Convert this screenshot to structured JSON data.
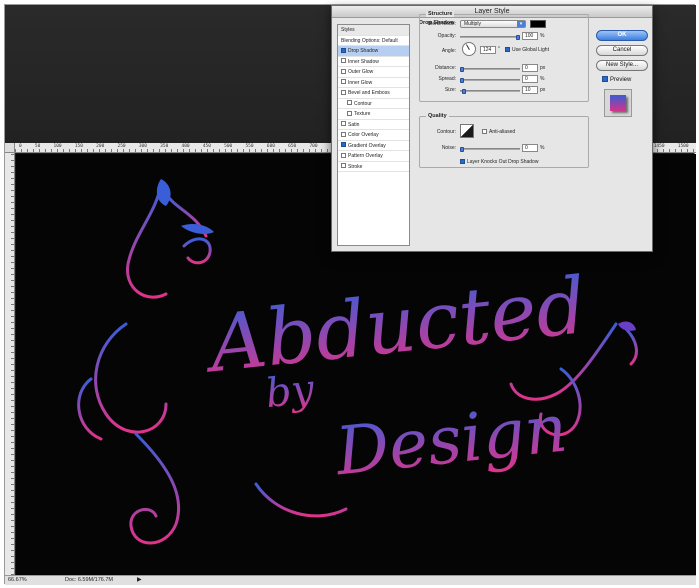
{
  "window": {
    "zoom_readout": "66.67%",
    "doc_info": "Doc: 6.59M/176.7M",
    "ruler_ticks": [
      "0",
      "50",
      "100",
      "150",
      "200",
      "250",
      "300",
      "350",
      "400",
      "450",
      "500",
      "550",
      "600",
      "650",
      "700",
      "750",
      "800",
      "850",
      "900",
      "950",
      "1000",
      "1050",
      "1100",
      "1150",
      "1200",
      "1250",
      "1300",
      "1350",
      "1400",
      "1450",
      "1500"
    ]
  },
  "artwork": {
    "line1": "Abducted",
    "line2": "by",
    "line3": "Design",
    "gradient_top": "#3a5ed8",
    "gradient_bottom": "#e0338a"
  },
  "dialog": {
    "title": "Layer Style",
    "styles_header": "Styles",
    "styles": [
      {
        "label": "Blending Options: Default",
        "checkbox": false,
        "checked": false,
        "selected": false,
        "sub": false
      },
      {
        "label": "Drop Shadow",
        "checkbox": true,
        "checked": true,
        "selected": true,
        "sub": false
      },
      {
        "label": "Inner Shadow",
        "checkbox": true,
        "checked": false,
        "selected": false,
        "sub": false
      },
      {
        "label": "Outer Glow",
        "checkbox": true,
        "checked": false,
        "selected": false,
        "sub": false
      },
      {
        "label": "Inner Glow",
        "checkbox": true,
        "checked": false,
        "selected": false,
        "sub": false
      },
      {
        "label": "Bevel and Emboss",
        "checkbox": true,
        "checked": false,
        "selected": false,
        "sub": false
      },
      {
        "label": "Contour",
        "checkbox": true,
        "checked": false,
        "selected": false,
        "sub": true
      },
      {
        "label": "Texture",
        "checkbox": true,
        "checked": false,
        "selected": false,
        "sub": true
      },
      {
        "label": "Satin",
        "checkbox": true,
        "checked": false,
        "selected": false,
        "sub": false
      },
      {
        "label": "Color Overlay",
        "checkbox": true,
        "checked": false,
        "selected": false,
        "sub": false
      },
      {
        "label": "Gradient Overlay",
        "checkbox": true,
        "checked": true,
        "selected": false,
        "sub": false
      },
      {
        "label": "Pattern Overlay",
        "checkbox": true,
        "checked": false,
        "selected": false,
        "sub": false
      },
      {
        "label": "Stroke",
        "checkbox": true,
        "checked": false,
        "selected": false,
        "sub": false
      }
    ],
    "section_title": "Drop Shadow",
    "structure_label": "Structure",
    "blend_mode_label": "Blend Mode:",
    "blend_mode_value": "Multiply",
    "shadow_color": "#000000",
    "opacity_label": "Opacity:",
    "opacity_value": "100",
    "opacity_unit": "%",
    "opacity_level": 1.0,
    "angle_label": "Angle:",
    "angle_value": "124",
    "angle_unit": "°",
    "global_light_label": "Use Global Light",
    "global_light_checked": true,
    "distance_label": "Distance:",
    "distance_value": "0",
    "distance_unit": "px",
    "distance_level": 0,
    "spread_label": "Spread:",
    "spread_value": "0",
    "spread_unit": "%",
    "spread_level": 0,
    "size_label": "Size:",
    "size_value": "10",
    "size_unit": "px",
    "size_level": 0.04,
    "quality_label": "Quality",
    "contour_label": "Contour:",
    "anti_aliased_label": "Anti-aliased",
    "noise_label": "Noise:",
    "noise_value": "0",
    "noise_unit": "%",
    "noise_level": 0,
    "knockout_label": "Layer Knocks Out Drop Shadow",
    "knockout_checked": true,
    "ok_label": "OK",
    "cancel_label": "Cancel",
    "new_style_label": "New Style...",
    "preview_label": "Preview"
  }
}
